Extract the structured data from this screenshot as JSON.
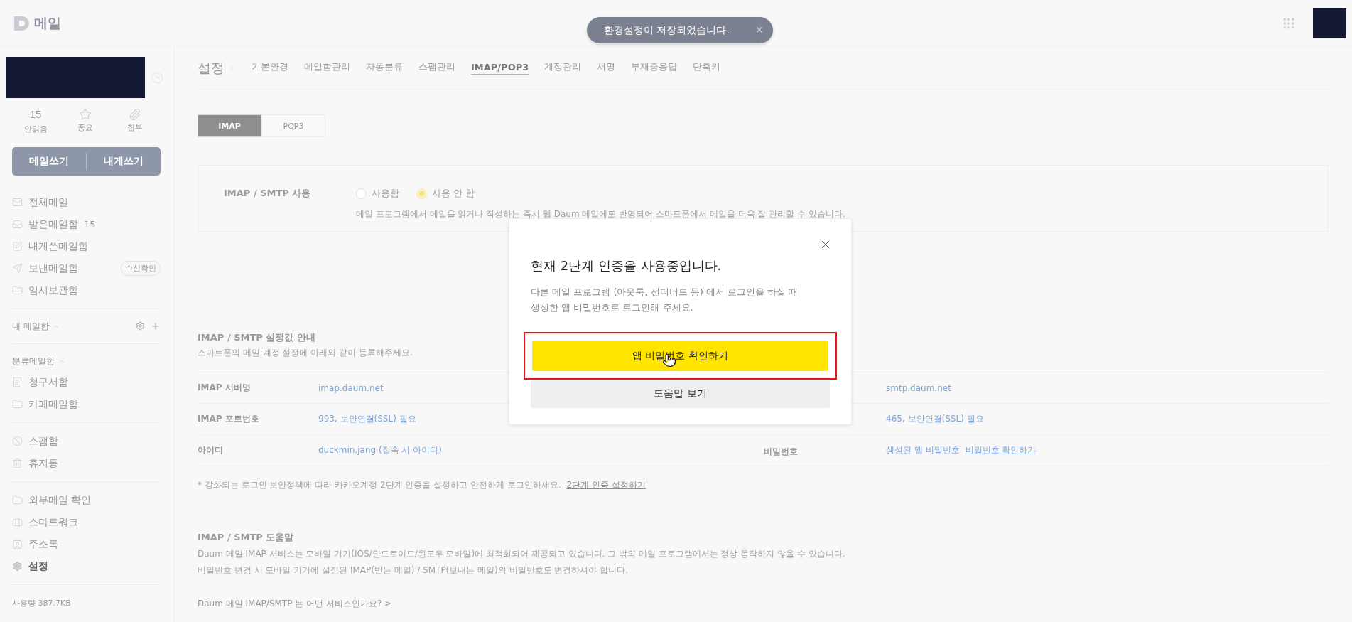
{
  "header": {
    "logo": "메일",
    "toast": {
      "text": "환경설정이 저장되었습니다.",
      "close": "×"
    }
  },
  "sidebar": {
    "stats": [
      {
        "kind": "count",
        "value": "15",
        "label": "안읽음"
      },
      {
        "kind": "icon",
        "label": "중요"
      },
      {
        "kind": "icon",
        "label": "첨부"
      }
    ],
    "compose_buttons": [
      "메일쓰기",
      "내게쓰기"
    ],
    "sections": [
      {
        "items": [
          {
            "label": "전체메일",
            "selected": false
          },
          {
            "label": "받은메일함",
            "count": "15",
            "selected": false
          },
          {
            "label": "내게쓴메일함",
            "selected": false
          },
          {
            "label": "보낸메일함",
            "badge": "수신확인",
            "selected": false
          },
          {
            "label": "임시보관함",
            "selected": false
          }
        ]
      },
      {
        "heading": "내 메일함",
        "expanded": true,
        "actions": true
      },
      {
        "heading": "분류메일함",
        "expanded": true,
        "items": [
          {
            "label": "청구서함",
            "selected": false
          },
          {
            "label": "카페메일함",
            "selected": false
          }
        ]
      },
      {
        "items": [
          {
            "label": "스팸함",
            "selected": false
          },
          {
            "label": "휴지통",
            "selected": false
          }
        ]
      },
      {
        "items": [
          {
            "label": "외부메일 확인",
            "selected": false
          },
          {
            "label": "스마트워크",
            "selected": false
          },
          {
            "label": "주소록",
            "selected": false
          },
          {
            "label": "설정",
            "selected": true
          }
        ]
      }
    ],
    "usage": "사용량 387.7KB"
  },
  "settings": {
    "title": "설정",
    "tabs": [
      {
        "label": "기본환경",
        "selected": false
      },
      {
        "label": "메일함관리",
        "selected": false
      },
      {
        "label": "자동분류",
        "selected": false
      },
      {
        "label": "스팸관리",
        "selected": false
      },
      {
        "label": "IMAP/POP3",
        "selected": true
      },
      {
        "label": "계정관리",
        "selected": false
      },
      {
        "label": "서명",
        "selected": false
      },
      {
        "label": "부재중응답",
        "selected": false
      },
      {
        "label": "단축키",
        "selected": false
      }
    ],
    "protocol_tabs": [
      {
        "label": "IMAP",
        "selected": true
      },
      {
        "label": "POP3",
        "selected": false
      }
    ],
    "usage_box": {
      "label": "IMAP / SMTP 사용",
      "options": [
        {
          "label": "사용함",
          "selected": false
        },
        {
          "label": "사용 안 함",
          "selected": true
        }
      ],
      "description": "메일 프로그램에서 메일을 읽거나 작성하는 즉시 웹 Daum 메일에도 반영되어 스마트폰에서 메일을 더욱 잘 관리할 수 있습니다."
    },
    "guide": {
      "title": "IMAP / SMTP 설정값 안내",
      "subtitle": "스마트폰의 메일 계정 설정에 아래와 같이 등록해주세요.",
      "rows": [
        {
          "label": "IMAP 서버명",
          "value": "imap.daum.net",
          "right_value": "smtp.daum.net"
        },
        {
          "label": "IMAP 포트번호",
          "value": "993, 보안연결(SSL) 필요",
          "right_value": "465, 보안연결(SSL) 필요"
        },
        {
          "label": "아이디",
          "value": "duckmin.jang (접속 시 아이디)",
          "right_label": "비밀번호",
          "right_value": "생성된 앱 비밀번호",
          "right_link": "비밀번호 확인하기"
        }
      ],
      "note": "* 강화되는 로그인 보안정책에 따라 카카오계정 2단계 인증을 설정하고 안전하게 로그인하세요.",
      "note_link": "2단계 인증 설정하기"
    },
    "help": {
      "title": "IMAP / SMTP 도움말",
      "lines": [
        "Daum 메일 IMAP 서비스는 모바일 기기(IOS/안드로이드/윈도우 모바일)에 최적화되어 제공되고 있습니다. 그 밖의 메일 프로그램에서는 정상 동작하지 않을 수 있습니다.",
        "비밀번호 변경 시 모바일 기기에 설정된 IMAP(받는 메일) / SMTP(보내는 메일)의 비밀번호도 변경하셔야 합니다."
      ],
      "link": "Daum 메일 IMAP/SMTP 는 어떤 서비스인가요? >"
    }
  },
  "modal": {
    "title": "현재 2단계 인증을 사용중입니다.",
    "text": "다른 메일 프로그램 (아웃룩, 선더버드 등) 에서 로그인을 하실 때 생성한 앱 비밀번호로 로그인해 주세요.",
    "primary": "앱 비밀번호 확인하기",
    "primary_highlighted": true,
    "secondary": "도움말 보기"
  }
}
